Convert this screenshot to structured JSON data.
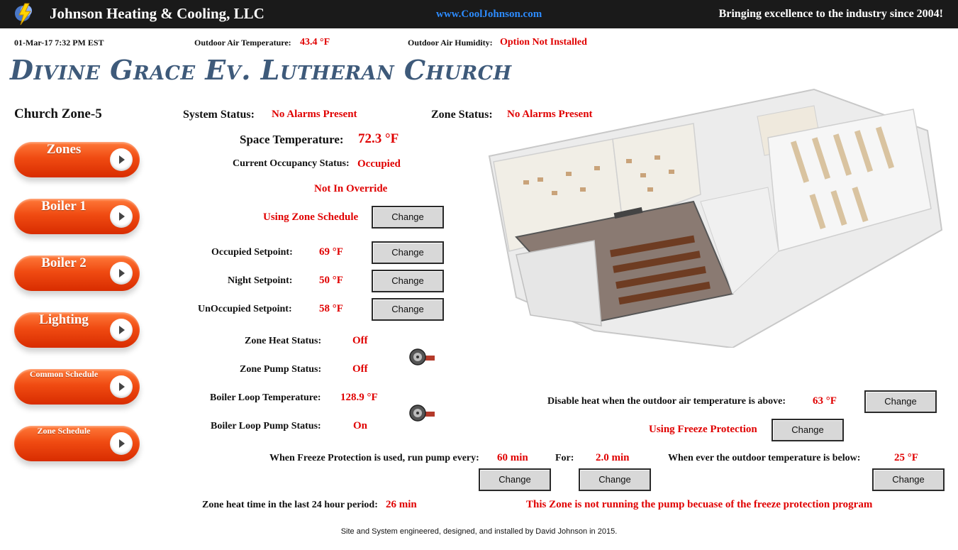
{
  "header": {
    "company": "Johnson Heating & Cooling, LLC",
    "website": "www.CoolJohnson.com",
    "tagline": "Bringing excellence to the industry since 2004!"
  },
  "info_bar": {
    "datetime": "01-Mar-17 7:32 PM EST",
    "oat_label": "Outdoor Air Temperature:",
    "oat_value": "43.4 °F",
    "oah_label": "Outdoor Air Humidity:",
    "oah_value": "Option Not Installed"
  },
  "church_title": "Divine Grace Ev. Lutheran Church",
  "zone_name": "Church Zone-5",
  "nav": [
    {
      "label": "Zones"
    },
    {
      "label": "Boiler 1"
    },
    {
      "label": "Boiler 2"
    },
    {
      "label": "Lighting"
    },
    {
      "label": "Common Schedule"
    },
    {
      "label": "Zone Schedule"
    }
  ],
  "status": {
    "system_label": "System Status:",
    "system_value": "No Alarms Present",
    "zone_label": "Zone Status:",
    "zone_value": "No Alarms Present",
    "space_temp_label": "Space Temperature:",
    "space_temp_value": "72.3 °F",
    "occupancy_label": "Current Occupancy Status:",
    "occupancy_value": "Occupied",
    "override_value": "Not In Override",
    "schedule_value": "Using Zone Schedule"
  },
  "setpoints": {
    "occupied_label": "Occupied Setpoint:",
    "occupied_value": "69 °F",
    "night_label": "Night Setpoint:",
    "night_value": "50 °F",
    "unoccupied_label": "UnOccupied Setpoint:",
    "unoccupied_value": "58 °F"
  },
  "equipment": {
    "heat_label": "Zone Heat Status:",
    "heat_value": "Off",
    "pump_label": "Zone Pump Status:",
    "pump_value": "Off",
    "loop_temp_label": "Boiler Loop Temperature:",
    "loop_temp_value": "128.9 °F",
    "loop_pump_label": "Boiler Loop Pump Status:",
    "loop_pump_value": "On"
  },
  "freeze": {
    "disable_label": "Disable heat when the outdoor air temperature is above:",
    "disable_value": "63 °F",
    "protection_value": "Using Freeze Protection",
    "run_label": "When Freeze Protection is used, run pump every:",
    "run_value": "60 min",
    "for_label": "For:",
    "for_value": "2.0 min",
    "below_label": "When ever the outdoor temperature is below:",
    "below_value": "25 °F",
    "heat_time_label": "Zone heat time in the last 24 hour period:",
    "heat_time_value": "26 min",
    "message": "This Zone is not running the pump becuase of the freeze protection program"
  },
  "change_label": "Change",
  "footer": "Site and System engineered, designed, and installed by David Johnson in 2015.",
  "colors": {
    "alert": "#e00000",
    "nav": "#f04b12",
    "title": "#3e5a7a",
    "link": "#2d8cff"
  }
}
